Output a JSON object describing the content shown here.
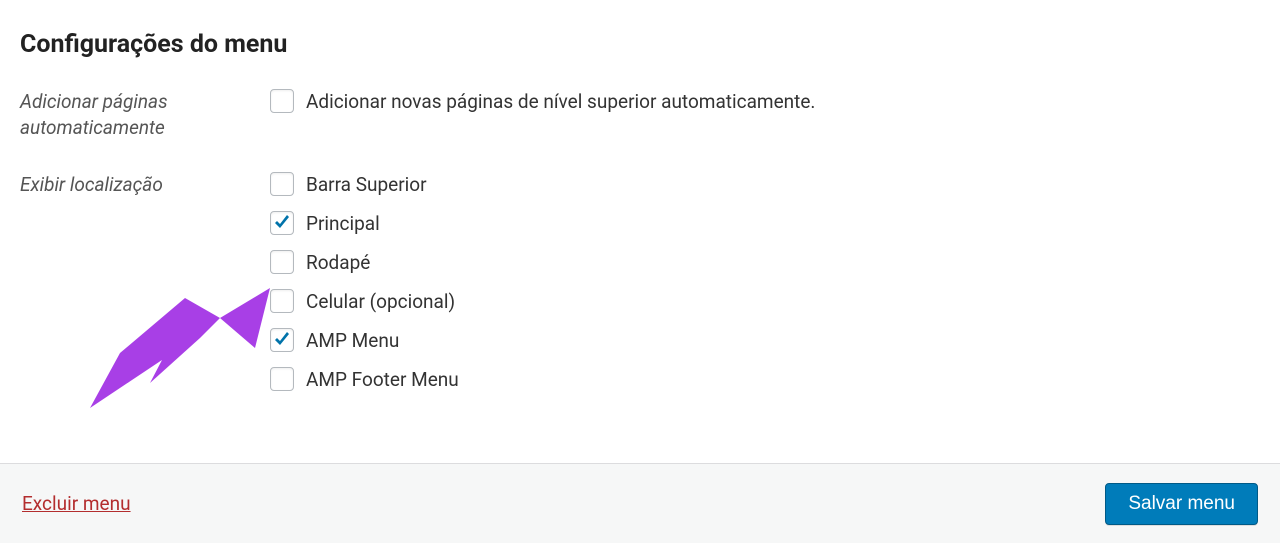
{
  "heading": "Configurações do menu",
  "auto_add": {
    "label": "Adicionar páginas automaticamente",
    "option": "Adicionar novas páginas de nível superior automaticamente.",
    "checked": false
  },
  "location": {
    "label": "Exibir localização",
    "options": [
      {
        "label": "Barra Superior",
        "checked": false
      },
      {
        "label": "Principal",
        "checked": true
      },
      {
        "label": "Rodapé",
        "checked": false
      },
      {
        "label": "Celular (opcional)",
        "checked": false
      },
      {
        "label": "AMP Menu",
        "checked": true
      },
      {
        "label": "AMP Footer Menu",
        "checked": false
      }
    ]
  },
  "footer": {
    "delete": "Excluir menu",
    "save": "Salvar menu"
  }
}
